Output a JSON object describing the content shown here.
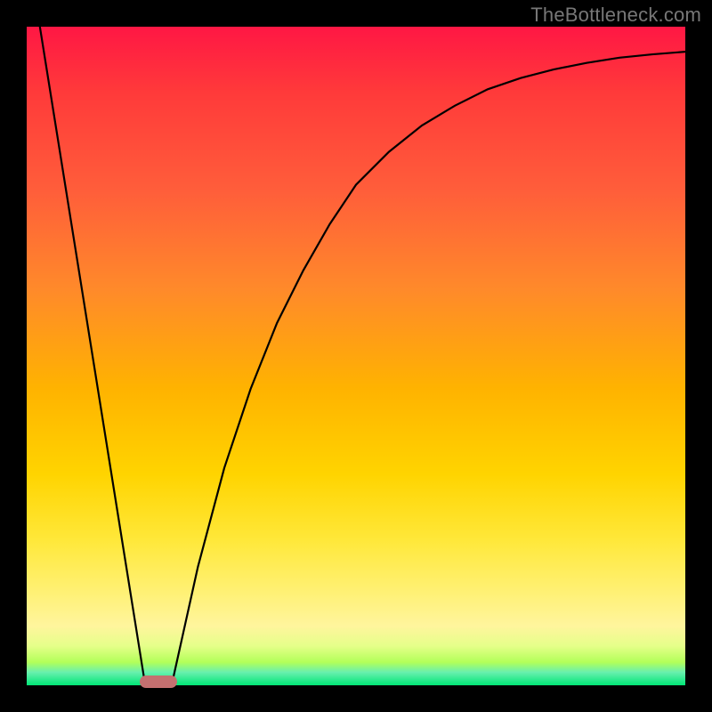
{
  "watermark": "TheBottleneck.com",
  "chart_data": {
    "type": "line",
    "title": "",
    "xlabel": "",
    "ylabel": "",
    "xlim": [
      0,
      1
    ],
    "ylim": [
      0,
      1
    ],
    "grid": false,
    "legend": false,
    "annotations": [],
    "series": [
      {
        "name": "left-segment",
        "x": [
          0.02,
          0.18
        ],
        "y": [
          1.0,
          0.0
        ]
      },
      {
        "name": "right-segment",
        "x": [
          0.22,
          0.26,
          0.3,
          0.34,
          0.38,
          0.42,
          0.46,
          0.5,
          0.55,
          0.6,
          0.65,
          0.7,
          0.75,
          0.8,
          0.85,
          0.9,
          0.95,
          1.0
        ],
        "y": [
          0.0,
          0.18,
          0.33,
          0.45,
          0.55,
          0.63,
          0.7,
          0.76,
          0.81,
          0.85,
          0.88,
          0.905,
          0.922,
          0.935,
          0.945,
          0.953,
          0.958,
          0.962
        ]
      }
    ],
    "markers": [
      {
        "name": "plateau-marker",
        "x": 0.2,
        "y": 0.005,
        "color": "#c47070"
      }
    ],
    "background_gradient": [
      {
        "pos": 0.0,
        "color": "#ff1744"
      },
      {
        "pos": 0.5,
        "color": "#ffb300"
      },
      {
        "pos": 0.85,
        "color": "#fff59d"
      },
      {
        "pos": 1.0,
        "color": "#00e676"
      }
    ]
  }
}
